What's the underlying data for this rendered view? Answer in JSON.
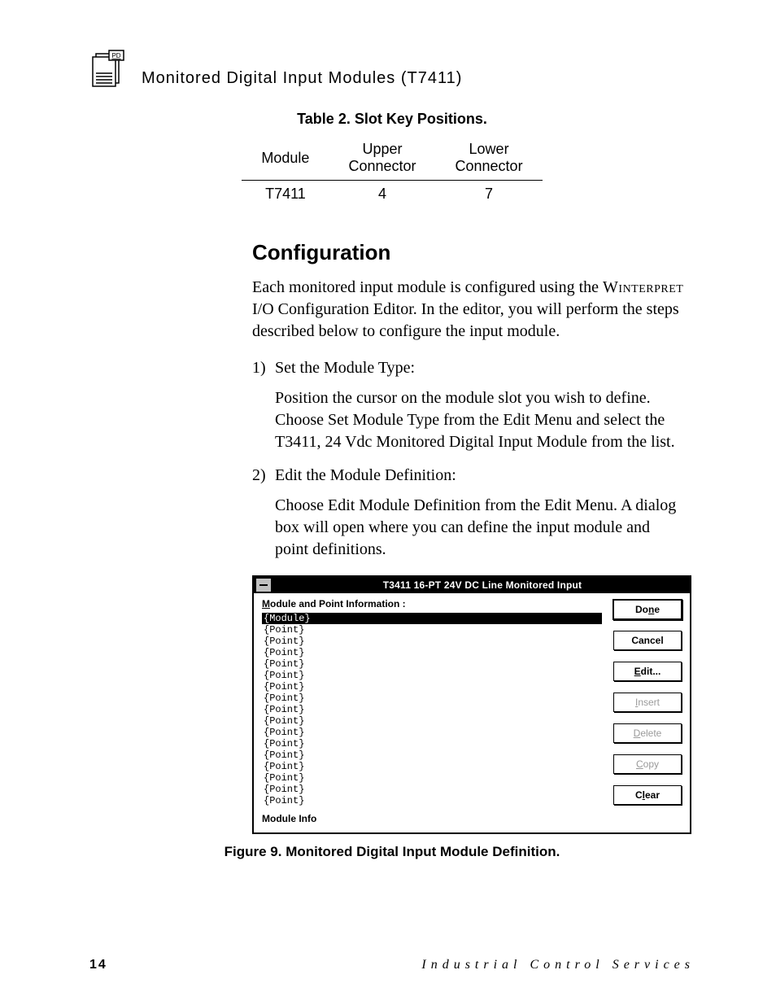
{
  "header": {
    "icon_label": "PD",
    "title": "Monitored  Digital  Input  Modules (T7411)"
  },
  "table2": {
    "caption": "Table 2.  Slot Key Positions.",
    "headers": [
      "Module",
      "Upper Connector",
      "Lower Connector"
    ],
    "rows": [
      {
        "module": "T7411",
        "upper": "4",
        "lower": "7"
      }
    ]
  },
  "section": {
    "heading": "Configuration",
    "intro_a": "Each monitored input module is configured using the ",
    "intro_smallcaps": "Winterpret",
    "intro_b": " I/O Configuration Editor.  In the editor, you will perform the steps described below to configure the input module.",
    "steps": [
      {
        "title": "Set the Module Type:",
        "body": "Position the cursor on the module slot you wish to define.  Choose Set Module Type from the Edit Menu and select the T3411, 24 Vdc Monitored Digital Input Module from the list."
      },
      {
        "title": "Edit the Module Definition:",
        "body": "Choose Edit Module Definition from the Edit Menu.  A dialog box will open where you can define the input module and point definitions."
      }
    ]
  },
  "dialog": {
    "title": "T3411 16-PT  24V DC Line Monitored Input",
    "label_prefix": "M",
    "label_rest": "odule and Point Information :",
    "list": [
      {
        "text": "{Module}",
        "selected": true
      },
      {
        "text": "{Point}",
        "selected": false
      },
      {
        "text": "{Point}",
        "selected": false
      },
      {
        "text": "{Point}",
        "selected": false
      },
      {
        "text": "{Point}",
        "selected": false
      },
      {
        "text": "{Point}",
        "selected": false
      },
      {
        "text": "{Point}",
        "selected": false
      },
      {
        "text": "{Point}",
        "selected": false
      },
      {
        "text": "{Point}",
        "selected": false
      },
      {
        "text": "{Point}",
        "selected": false
      },
      {
        "text": "{Point}",
        "selected": false
      },
      {
        "text": "{Point}",
        "selected": false
      },
      {
        "text": "{Point}",
        "selected": false
      },
      {
        "text": "{Point}",
        "selected": false
      },
      {
        "text": "{Point}",
        "selected": false
      },
      {
        "text": "{Point}",
        "selected": false
      },
      {
        "text": "{Point}",
        "selected": false
      }
    ],
    "module_info_label": "Module Info",
    "buttons": {
      "done": {
        "pre": "Do",
        "ul": "n",
        "post": "e",
        "disabled": false,
        "default": true
      },
      "cancel": {
        "pre": "",
        "ul": "",
        "post": "Cancel",
        "disabled": false,
        "default": false
      },
      "edit": {
        "pre": "",
        "ul": "E",
        "post": "dit...",
        "disabled": false,
        "default": false
      },
      "insert": {
        "pre": "",
        "ul": "I",
        "post": "nsert",
        "disabled": true,
        "default": false
      },
      "delete": {
        "pre": "",
        "ul": "D",
        "post": "elete",
        "disabled": true,
        "default": false
      },
      "copy": {
        "pre": "",
        "ul": "C",
        "post": "opy",
        "disabled": true,
        "default": false
      },
      "clear": {
        "pre": "C",
        "ul": "l",
        "post": "ear",
        "disabled": false,
        "default": false
      }
    }
  },
  "figure_caption": "Figure 9.  Monitored Digital Input Module Definition.",
  "footer": {
    "page": "14",
    "publication": "Industrial    Control    Services"
  }
}
